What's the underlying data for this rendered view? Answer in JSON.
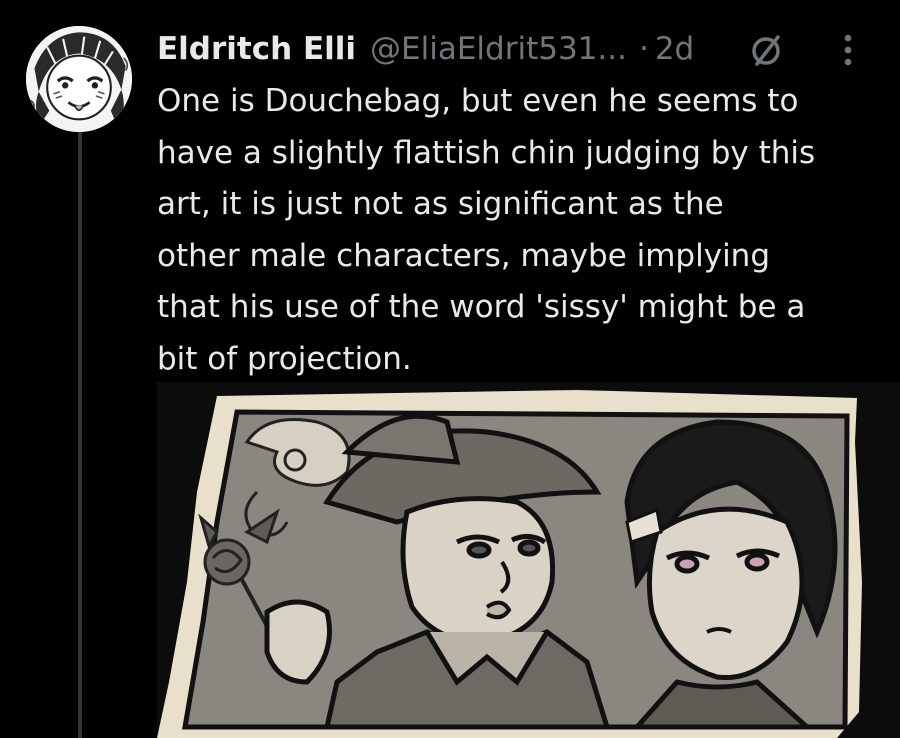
{
  "tweet": {
    "author": {
      "display_name": "Eldritch Elli",
      "handle": "@EliaEldrit531...",
      "avatar_icon": "avatar-drawing-icon"
    },
    "separator": "·",
    "time": "2d",
    "badge_icon": "slashed-circle-icon",
    "more_icon": "more-vertical-icon",
    "text": "One is Douchebag, but even he seems to\nhave a slightly flattish chin judging by this\nart, it is just not as significant as the\nother male characters, maybe implying\nthat his use of the word 'sissy' might be a\nbit of projection."
  },
  "media": {
    "kind": "illustration",
    "icon": "comic-panel-illustration"
  },
  "colors": {
    "background": "#000000",
    "text_primary": "#e7e9ea",
    "text_secondary": "#71767b",
    "thread_line": "#333639",
    "panel_cream": "#e9e0cc",
    "ink": "#111111"
  }
}
